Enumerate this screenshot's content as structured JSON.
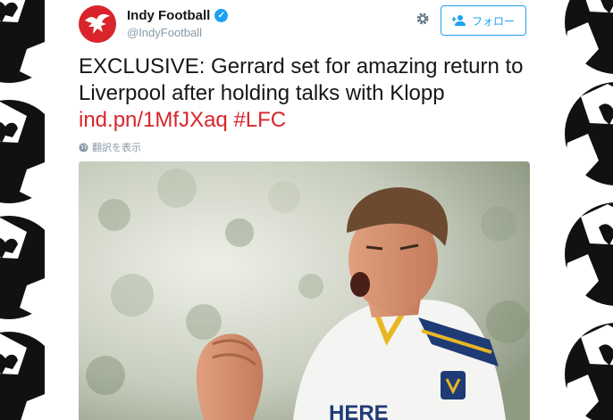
{
  "tweet": {
    "display_name": "Indy Football",
    "handle": "@IndyFootball",
    "follow_label": "フォロー",
    "text_main": "EXCLUSIVE: Gerrard set for amazing return to Liverpool after holding talks with Klopp ",
    "link": "ind.pn/1MfJXaq",
    "hashtag": "#LFC",
    "translate_label": "翻訳を表示",
    "jersey_text": "HERE"
  },
  "colors": {
    "accent_red": "#d9242b",
    "twitter_blue": "#1da1f2",
    "text_dark": "#14171a",
    "text_muted": "#8899a6"
  },
  "icons": {
    "avatar": "eagle-logo-icon",
    "verified": "verified-badge-icon",
    "settings": "gear-icon",
    "follow": "add-person-icon",
    "translate": "globe-icon"
  }
}
